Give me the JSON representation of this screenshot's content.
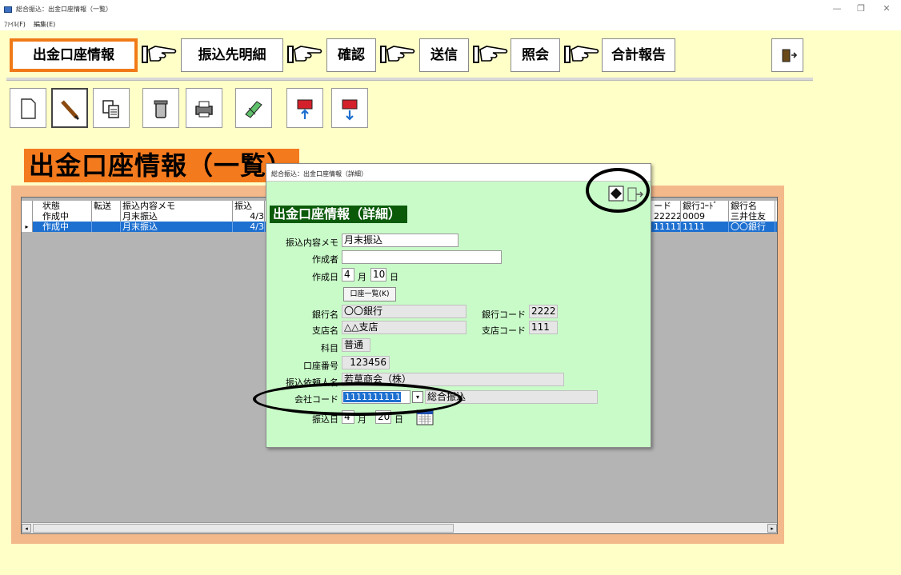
{
  "window": {
    "title": "総合振込：出金口座情報（一覧）",
    "min": "—",
    "max": "❐",
    "close": "✕"
  },
  "menu": {
    "file": "ﾌｧｲﾙ(F)",
    "edit": "編集(E)"
  },
  "steps": [
    "出金口座情報",
    "振込先明細",
    "確認",
    "送信",
    "照会",
    "合計報告"
  ],
  "toolbar": [
    "new-document",
    "edit-pencil",
    "copy",
    "delete-trash",
    "print",
    "transfer",
    "import",
    "export"
  ],
  "list": {
    "title": "出金口座情報（一覧）",
    "columns": [
      "状態",
      "転送",
      "振込内容メモ",
      "振込",
      "ード",
      "銀行ｺｰﾄﾞ",
      "銀行名"
    ],
    "rows": [
      {
        "status": "作成中",
        "transfer": "",
        "memo": "月末振込",
        "date": "4/3",
        "code": "22222",
        "bank_code": "0009",
        "bank": "三井住友"
      },
      {
        "status": "作成中",
        "transfer": "",
        "memo": "月末振込",
        "date": "4/3",
        "code": "11111",
        "bank_code": "1111",
        "bank": "〇〇銀行"
      }
    ],
    "row_marker": "▸"
  },
  "dialog": {
    "title": "総合振込：出金口座情報（詳細）",
    "heading": "出金口座情報（詳細）",
    "labels": {
      "memo": "振込内容メモ",
      "author": "作成者",
      "created": "作成日",
      "bank_name": "銀行名",
      "bank_code": "銀行コード",
      "branch_name": "支店名",
      "branch_code": "支店コード",
      "subject": "科目",
      "account_no": "口座番号",
      "requester": "振込依頼人名",
      "company_code": "会社コード",
      "transfer_date": "振込日",
      "month": "月",
      "day": "日"
    },
    "values": {
      "memo": "月末振込",
      "author": "",
      "created_month": "4",
      "created_day": "10",
      "bank_name": "〇〇銀行",
      "bank_code": "2222",
      "branch_name": "△△支店",
      "branch_code": "111",
      "subject": "普通",
      "account_no": "123456",
      "requester": "若草商会（株）",
      "company_code": "1111111111",
      "company_name": "総合振込",
      "transfer_month": "4",
      "transfer_day": "20"
    },
    "account_list_button": "口座一覧(K)"
  }
}
